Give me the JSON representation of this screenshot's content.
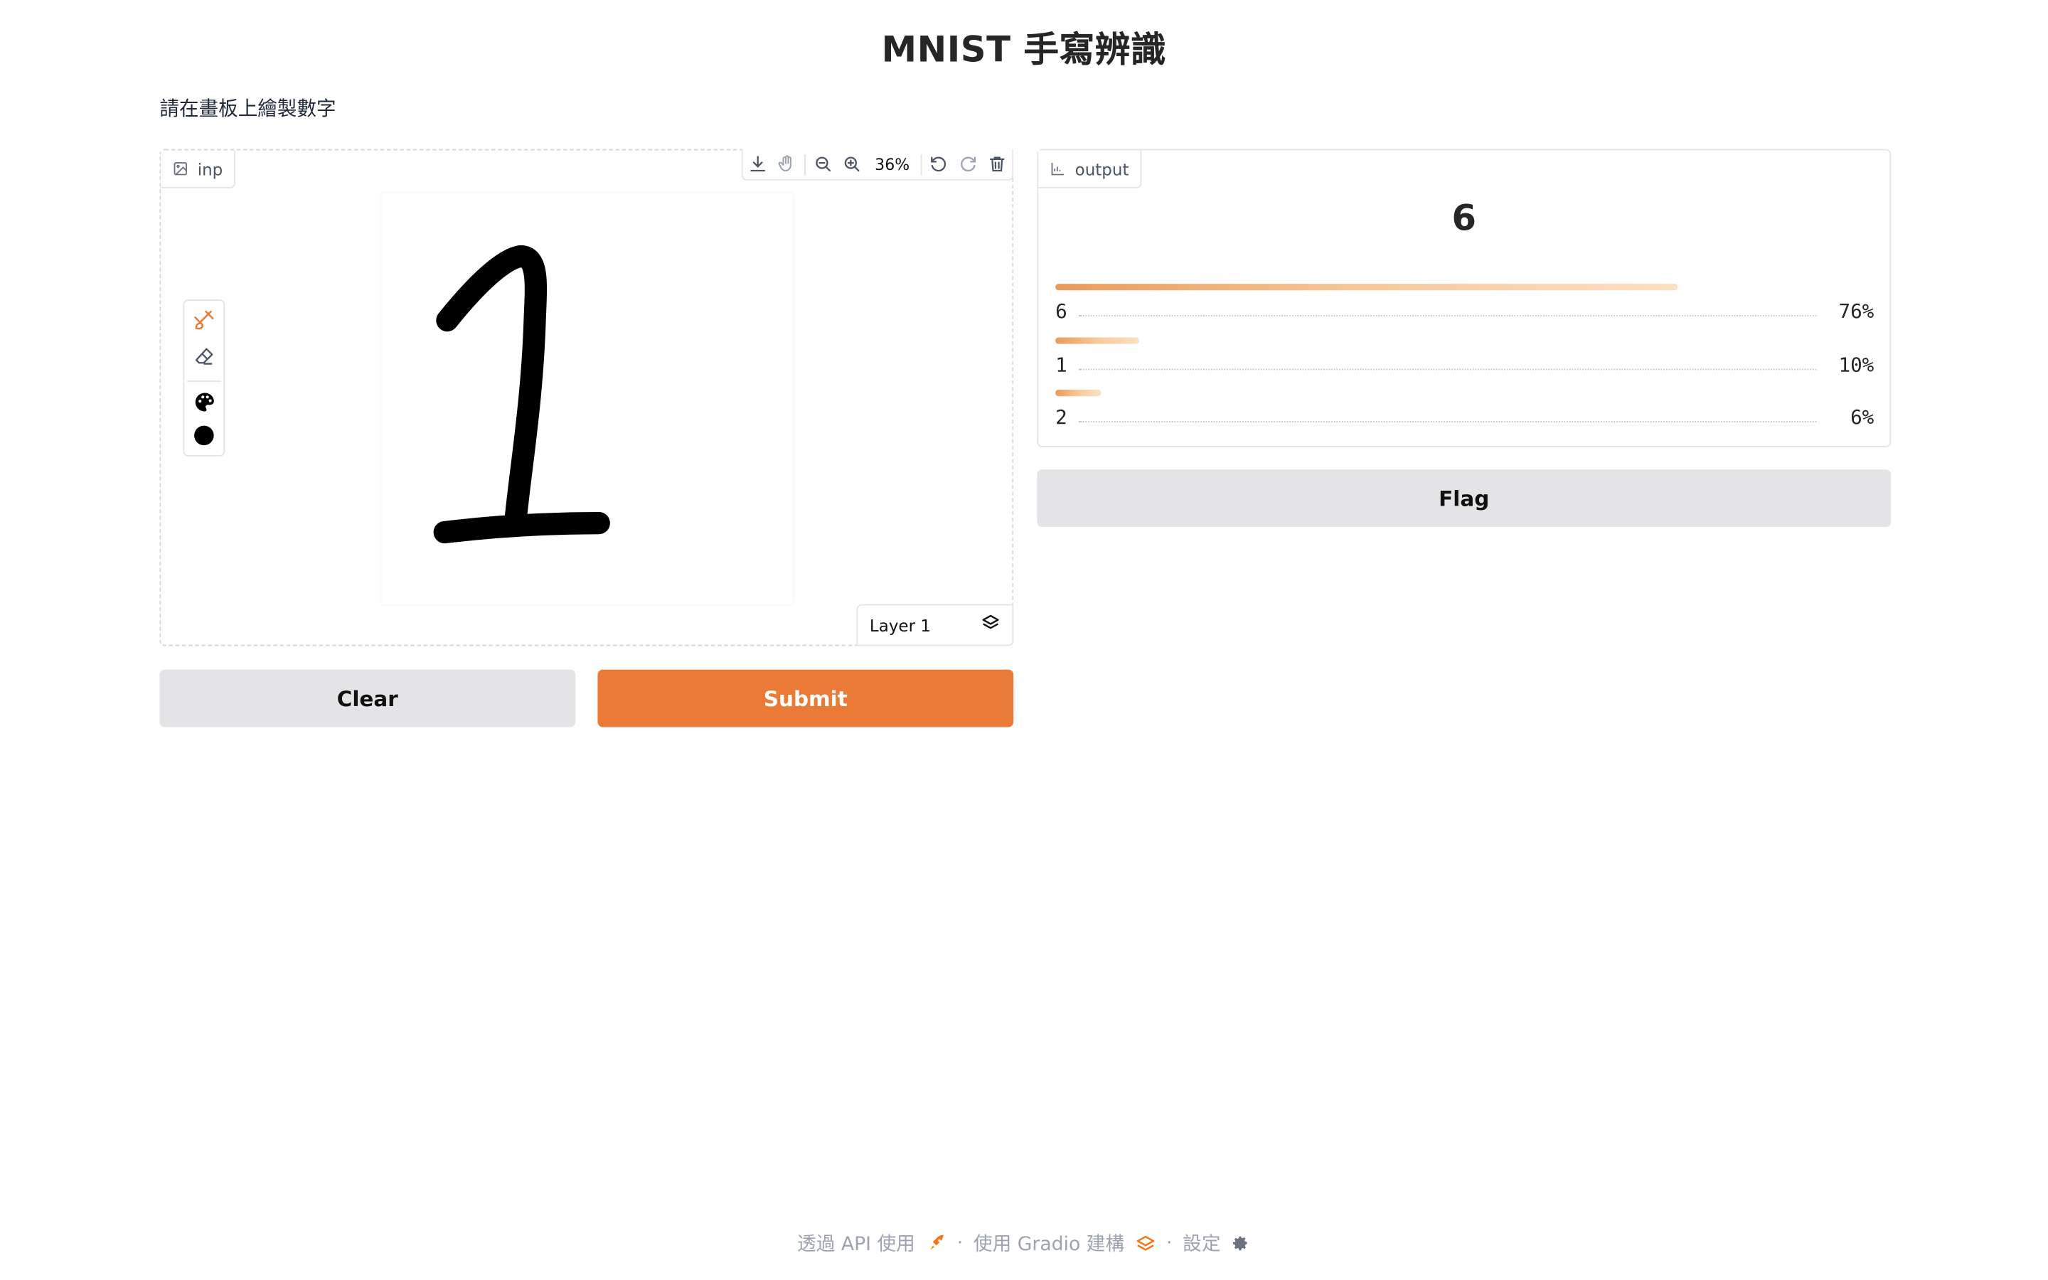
{
  "app": {
    "title": "MNIST 手寫辨識",
    "description": "請在畫板上繪製數字"
  },
  "input_panel": {
    "label": "inp",
    "label_icon": "image-icon",
    "zoom": "36%",
    "toolbar_icons": [
      "download-icon",
      "pan-hand-icon",
      "zoom-out-icon",
      "zoom-in-icon",
      "undo-icon",
      "redo-icon",
      "trash-icon"
    ],
    "tools": [
      "brush-icon",
      "eraser-icon",
      "palette-icon",
      "brush-size-dot-icon"
    ],
    "layer_label": "Layer 1",
    "layer_icon": "layers-icon",
    "stroke_color": "#000000"
  },
  "buttons": {
    "clear": "Clear",
    "submit": "Submit",
    "flag": "Flag",
    "submit_color": "#ea7a35"
  },
  "output_panel": {
    "label": "output",
    "label_icon": "bar-chart-icon",
    "top_prediction": "6",
    "confidences": [
      {
        "label": "6",
        "percent": "76%",
        "value": 0.76
      },
      {
        "label": "1",
        "percent": "10%",
        "value": 0.1
      },
      {
        "label": "2",
        "percent": "6%",
        "value": 0.06
      }
    ]
  },
  "footer": {
    "api": "透過 API 使用",
    "api_icon": "rocket-icon",
    "sep1": "·",
    "built": "使用 Gradio 建構",
    "built_icon": "gradio-logo-icon",
    "sep2": "·",
    "settings": "設定",
    "settings_icon": "gear-icon"
  }
}
